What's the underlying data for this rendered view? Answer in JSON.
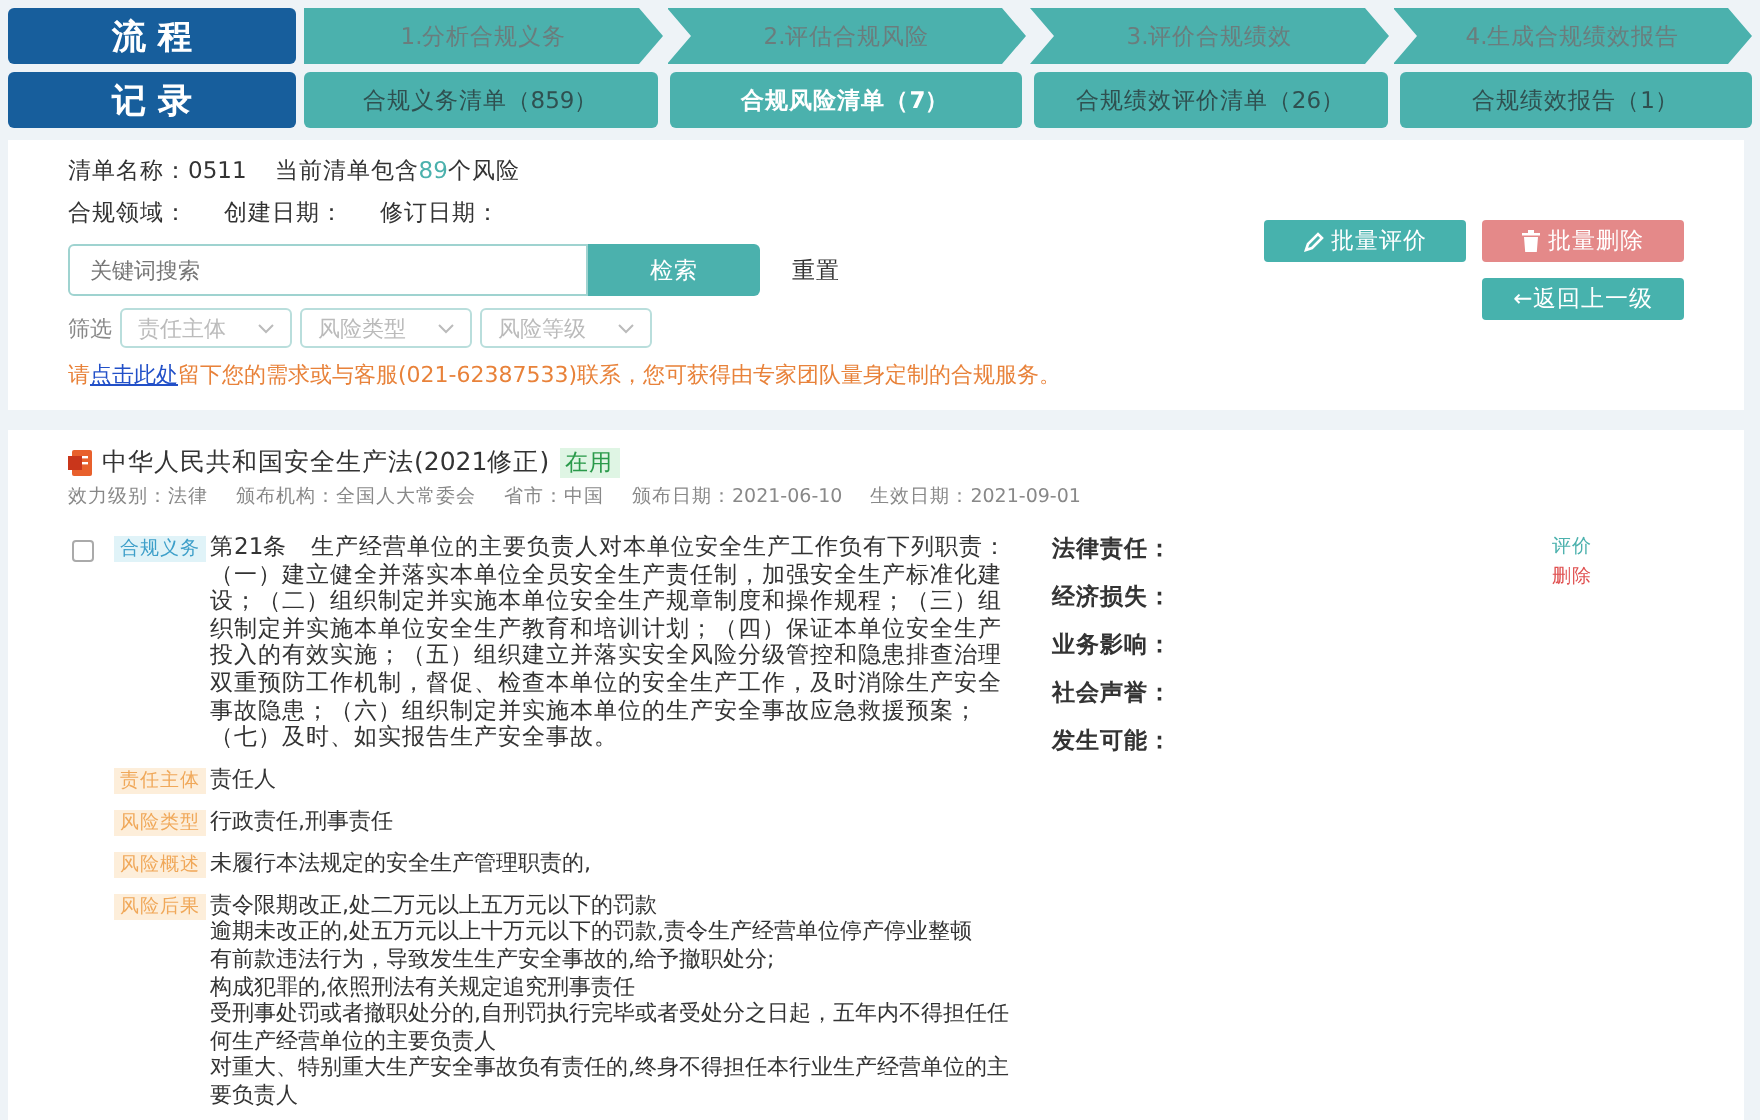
{
  "flow": {
    "label": "流 程",
    "steps": [
      {
        "label": "1.分析合规义务"
      },
      {
        "label": "2.评估合规风险"
      },
      {
        "label": "3.评价合规绩效"
      },
      {
        "label": "4.生成合规绩效报告"
      }
    ]
  },
  "records": {
    "label": "记 录",
    "tabs": [
      {
        "label": "合规义务清单（859）",
        "selected": false
      },
      {
        "label": "合规风险清单（7）",
        "selected": true
      },
      {
        "label": "合规绩效评价清单（26）",
        "selected": false
      },
      {
        "label": "合规绩效报告（1）",
        "selected": false
      }
    ]
  },
  "list_info": {
    "name_label": "清单名称：",
    "name": "0511",
    "count_prefix": "当前清单包含",
    "count": "89",
    "count_suffix": "个风险",
    "fields": [
      "合规领域：",
      "创建日期：",
      "修订日期："
    ]
  },
  "search": {
    "placeholder": "关键词搜索",
    "button": "检索",
    "reset": "重置"
  },
  "filter": {
    "label": "筛选",
    "selects": [
      {
        "placeholder": "责任主体"
      },
      {
        "placeholder": "风险类型"
      },
      {
        "placeholder": "风险等级"
      }
    ]
  },
  "notice": {
    "before": "请",
    "link": "点击此处",
    "after": "留下您的需求或与客服(021-62387533)联系，您可获得由专家团队量身定制的合规服务。"
  },
  "actions": [
    {
      "kind": "edit",
      "label": "批量评价"
    },
    {
      "kind": "delete",
      "label": "批量删除"
    },
    {
      "kind": "back",
      "label": "←返回上一级"
    }
  ],
  "law": {
    "title": "中华人民共和国安全生产法(2021修正)",
    "status": "在用",
    "meta": [
      "效力级别：法律",
      "颁布机构：全国人大常委会",
      "省市：中国",
      "颁布日期：2021-06-10",
      "生效日期：2021-09-01"
    ]
  },
  "item": {
    "checked": false,
    "tag": "合规义务",
    "text": "第21条　生产经营单位的主要负责人对本单位安全生产工作负有下列职责：（一）建立健全并落实本单位全员安全生产责任制，加强安全生产标准化建设；（二）组织制定并实施本单位安全生产规章制度和操作规程；（三）组织制定并实施本单位安全生产教育和培训计划；（四）保证本单位安全生产投入的有效实施；（五）组织建立并落实安全风险分级管控和隐患排查治理双重预防工作机制，督促、检查本单位的安全生产工作，及时消除生产安全事故隐患；（六）组织制定并实施本单位的生产安全事故应急救援预案；（七）及时、如实报告生产安全事故。",
    "risks": [
      {
        "tag": "责任主体",
        "lines": [
          "责任人"
        ]
      },
      {
        "tag": "风险类型",
        "lines": [
          "行政责任,刑事责任"
        ]
      },
      {
        "tag": "风险概述",
        "lines": [
          "未履行本法规定的安全生产管理职责的,"
        ]
      },
      {
        "tag": "风险后果",
        "lines": [
          "责令限期改正,处二万元以上五万元以下的罚款",
          "逾期未改正的,处五万元以上十万元以下的罚款,责令生产经营单位停产停业整顿",
          "有前款违法行为，导致发生生产安全事故的,给予撤职处分;",
          "构成犯罪的,依照刑法有关规定追究刑事责任",
          "受刑事处罚或者撤职处分的,自刑罚执行完毕或者受处分之日起，五年内不得担任任何生产经营单位的主要负责人",
          "对重大、特别重大生产安全事故负有责任的,终身不得担任本行业生产经营单位的主要负责人"
        ]
      }
    ],
    "assessment": [
      "法律责任：",
      "经济损失：",
      "业务影响：",
      "社会声誉：",
      "发生可能："
    ],
    "links": [
      {
        "kind": "evaluate",
        "label": "评价"
      },
      {
        "kind": "delete",
        "label": "删除"
      }
    ]
  }
}
